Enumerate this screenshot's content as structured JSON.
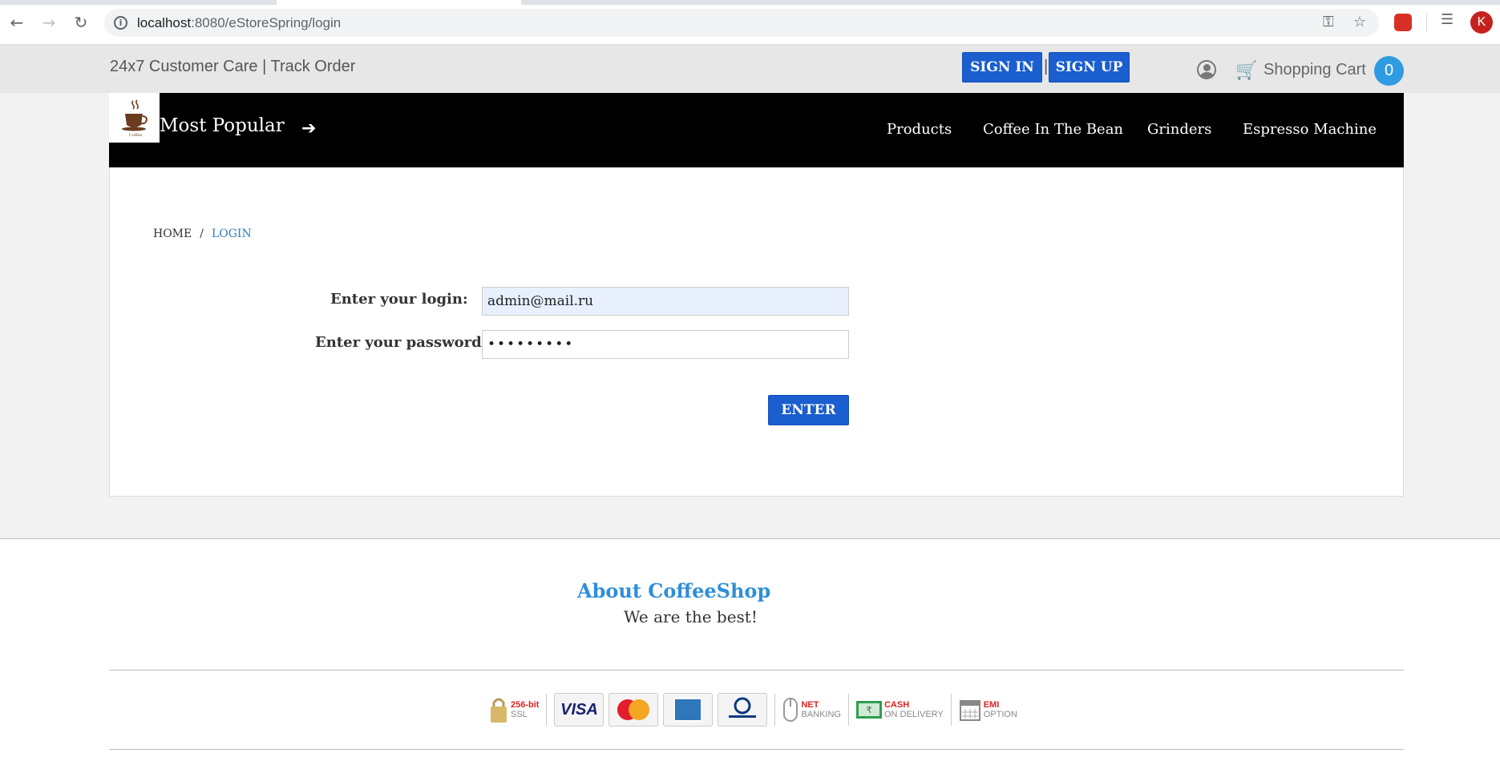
{
  "browser": {
    "url_host": "localhost",
    "url_path": ":8080/eStoreSpring/login",
    "profile_initial": "K"
  },
  "top_bar": {
    "customer_care": "24x7 Customer Care | Track Order",
    "sign_in": "SIGN IN",
    "separator": "|",
    "sign_up": "SIGN UP",
    "cart_label": "Shopping Cart",
    "cart_count": "0"
  },
  "nav": {
    "title": "Most Popular",
    "links": [
      "Products",
      "Coffee In The Bean",
      "Grinders",
      "Espresso Machine"
    ]
  },
  "breadcrumb": {
    "home": "HOME",
    "separator": "/",
    "current": "LOGIN"
  },
  "form": {
    "login_label": "Enter your login:",
    "login_value": "admin@mail.ru",
    "password_label": "Enter your password:",
    "password_value": "•••••••••",
    "submit_label": "ENTER"
  },
  "footer": {
    "about_title": "About CoffeeShop",
    "about_text": "We are the best!",
    "payments": {
      "ssl_top": "256-bit",
      "ssl_bottom": "SSL",
      "visa": "VISA",
      "net_top": "NET",
      "net_bottom": "BANKING",
      "cash_top": "CASH",
      "cash_bottom": "ON DELIVERY",
      "emi_top": "EMI",
      "emi_bottom": "OPTION"
    }
  },
  "colors": {
    "accent_blue": "#1a5ecf",
    "link_blue": "#2f8fd8",
    "nav_black": "#000000",
    "cart_badge": "#2f9be1"
  }
}
